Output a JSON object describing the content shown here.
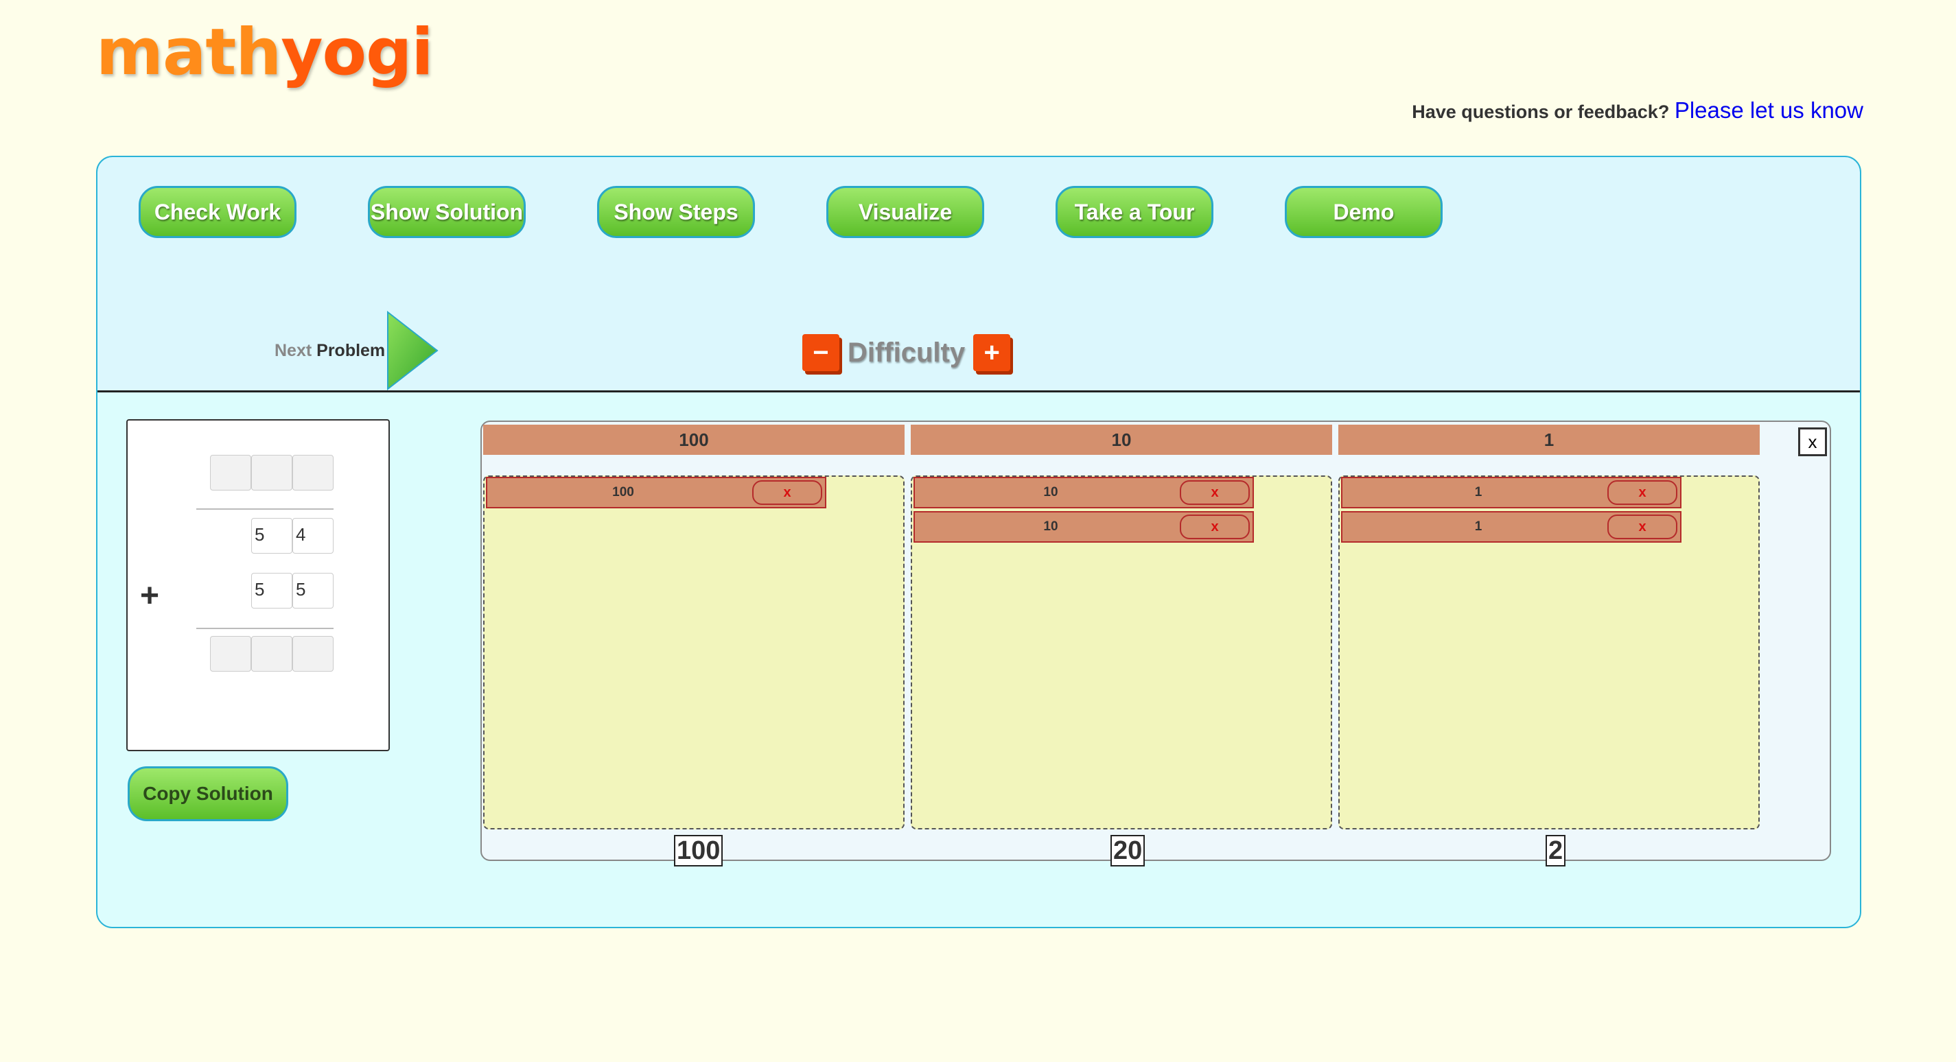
{
  "logo": {
    "part1": "math",
    "part2": "yogi"
  },
  "feedback": {
    "text": "Have questions or feedback?",
    "link": "Please let us know"
  },
  "toolbar": {
    "check_work": "Check Work",
    "show_solution": "Show Solution",
    "show_steps": "Show Steps",
    "visualize": "Visualize",
    "take_tour": "Take a Tour",
    "demo": "Demo"
  },
  "next_problem": {
    "word1": "Next",
    "word2": "Problem"
  },
  "difficulty": {
    "label": "Difficulty",
    "minus": "−",
    "plus": "+"
  },
  "problem": {
    "operator": "+",
    "addend1": [
      "5",
      "4"
    ],
    "addend2": [
      "5",
      "5"
    ]
  },
  "copy_solution": "Copy Solution",
  "visualization": {
    "close": "x",
    "columns": [
      {
        "header": "100",
        "blocks": [
          {
            "label": "100",
            "remove": "x"
          }
        ],
        "total": "100"
      },
      {
        "header": "10",
        "blocks": [
          {
            "label": "10",
            "remove": "x"
          },
          {
            "label": "10",
            "remove": "x"
          }
        ],
        "total": "20"
      },
      {
        "header": "1",
        "blocks": [
          {
            "label": "1",
            "remove": "x"
          },
          {
            "label": "1",
            "remove": "x"
          }
        ],
        "total": "2"
      }
    ]
  },
  "colors": {
    "background": "#fefeea",
    "panel": "#dcf7fd",
    "button_green": "#6cc93a",
    "block": "#d4906e",
    "work_area": "#f2f5bc",
    "accent_orange": "#f24b0a"
  }
}
